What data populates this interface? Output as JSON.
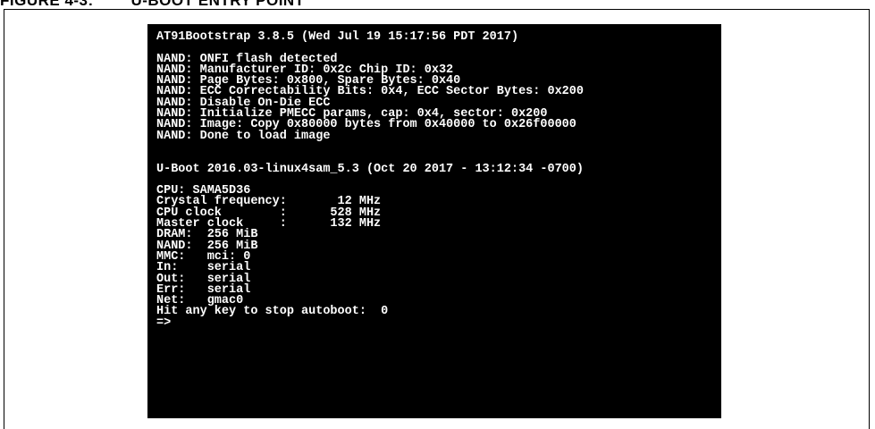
{
  "figure_caption": "FIGURE 4-3:        U-BOOT ENTRY POINT",
  "terminal": {
    "bootstrap_header": "AT91Bootstrap 3.8.5 (Wed Jul 19 15:17:56 PDT 2017)",
    "nand_lines": [
      "NAND: ONFI flash detected",
      "NAND: Manufacturer ID: 0x2c Chip ID: 0x32",
      "NAND: Page Bytes: 0x800, Spare Bytes: 0x40",
      "NAND: ECC Correctability Bits: 0x4, ECC Sector Bytes: 0x200",
      "NAND: Disable On-Die ECC",
      "NAND: Initialize PMECC params, cap: 0x4, sector: 0x200",
      "NAND: Image: Copy 0x80000 bytes from 0x40000 to 0x26f00000",
      "NAND: Done to load image"
    ],
    "uboot_header": "U-Boot 2016.03-linux4sam_5.3 (Oct 20 2017 - 13:12:34 -0700)",
    "system_lines": [
      "CPU: SAMA5D36",
      "Crystal frequency:       12 MHz",
      "CPU clock        :      528 MHz",
      "Master clock     :      132 MHz",
      "DRAM:  256 MiB",
      "NAND:  256 MiB",
      "MMC:   mci: 0",
      "In:    serial",
      "Out:   serial",
      "Err:   serial",
      "Net:   gmac0",
      "Hit any key to stop autoboot:  0",
      "=>"
    ]
  }
}
